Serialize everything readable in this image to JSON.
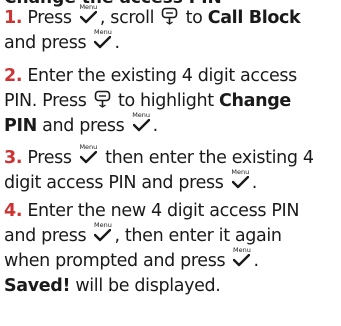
{
  "heading": "Change the access PIN",
  "keys": {
    "menu": "Menu",
    "menu_icon": "menu-tick-icon",
    "nav_icon": "scroll-updown-icon"
  },
  "colors": {
    "accent": "#cc3333",
    "text": "#1a1a1a"
  },
  "steps": [
    {
      "number": "1.",
      "line1_a": "Press",
      "line1_b": ", scroll",
      "line1_c": "to",
      "target": "Call Block",
      "line2_a": "and press",
      "line2_end": "."
    },
    {
      "number": "2.",
      "line1": "Enter the existing 4 digit access",
      "line2_a": "PIN. Press",
      "line2_b": "to highlight",
      "target_1": "Change",
      "target_2": "PIN",
      "line3_a": "and press",
      "line3_end": "."
    },
    {
      "number": "3.",
      "line1_a": "Press",
      "line1_b": "then enter the existing 4",
      "line2": "digit access PIN and press",
      "line2_end": "."
    },
    {
      "number": "4.",
      "line1": "Enter the new 4 digit access PIN",
      "line2_a": "and press",
      "line2_b": ", then enter it again",
      "line3_a": "when prompted and press",
      "line3_end": ".",
      "saved": "Saved!",
      "saved_suffix": "will be displayed."
    }
  ]
}
